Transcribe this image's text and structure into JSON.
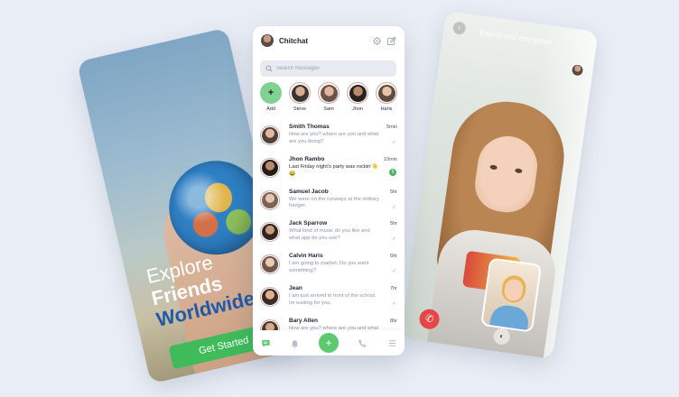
{
  "welcome": {
    "line1": "Explore",
    "line2": "Friends",
    "line3": "Worldwide",
    "cta_label": "Get Started"
  },
  "call": {
    "encryption_text": "End-to-end encrypted"
  },
  "chat_app": {
    "title": "Chitchat",
    "search_placeholder": "Search messages",
    "stories": [
      {
        "name": "Add"
      },
      {
        "name": "Steve"
      },
      {
        "name": "Sam"
      },
      {
        "name": "Jhon"
      },
      {
        "name": "Haris"
      }
    ],
    "chats": [
      {
        "name": "Smith Thomas",
        "message": "How are you? where are you and what are you doing?",
        "time": "5min",
        "status": "read"
      },
      {
        "name": "Jhon Rambo",
        "message": "Last Friday night's party was rockin'👋😂",
        "time": "10min",
        "status": "unread",
        "unread_count": "5"
      },
      {
        "name": "Samuel Jacob",
        "message": "We were on the runways at the military hanger.",
        "time": "5hr",
        "status": "read"
      },
      {
        "name": "Jack Sparrow",
        "message": "What kind of music do you like and what app do you use?",
        "time": "5hr",
        "status": "read"
      },
      {
        "name": "Calvin Haris",
        "message": "I am going to market. Do you want something?",
        "time": "6hr",
        "status": "read"
      },
      {
        "name": "Jean",
        "message": "I am just arrived in front of the school. Im waiting for you.",
        "time": "7hr",
        "status": "read"
      },
      {
        "name": "Bary Allen",
        "message": "How are you? where are you and what are you doing?",
        "time": "8hr",
        "status": "read"
      }
    ]
  },
  "colors": {
    "accent": "#5cc870",
    "story_ring": "#d5a7a1",
    "end_call": "#e64646",
    "background": "#e9edf5"
  }
}
